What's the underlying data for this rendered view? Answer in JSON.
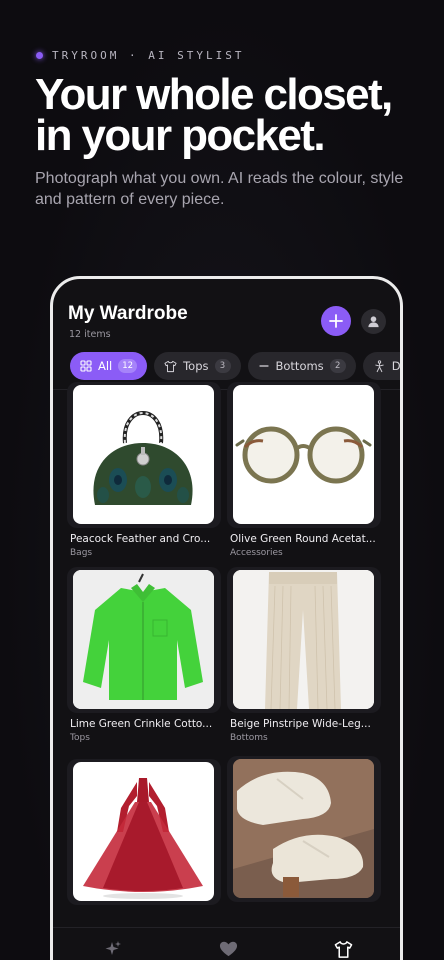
{
  "hero": {
    "eyebrow": "TRYROOM · AI STYLIST",
    "headline_line1": "Your whole closet,",
    "headline_line2": "in your pocket.",
    "subhead": "Photograph what you own. AI reads the colour, style and pattern of every piece."
  },
  "app": {
    "title": "My Wardrobe",
    "count": "12 items",
    "accent": "#8b5cf6",
    "chips": [
      {
        "label": "All",
        "count": "12",
        "icon": "grid-icon",
        "active": true
      },
      {
        "label": "Tops",
        "count": "3",
        "icon": "shirt-icon",
        "active": false
      },
      {
        "label": "Bottoms",
        "count": "2",
        "icon": "minus-icon",
        "active": false
      },
      {
        "label": "Dr",
        "count": "",
        "icon": "dress-icon",
        "active": false
      }
    ],
    "items": [
      {
        "name": "Peacock Feather and Cro...",
        "category": "Bags"
      },
      {
        "name": "Olive Green Round Acetat...",
        "category": "Accessories"
      },
      {
        "name": "Lime Green Crinkle Cotto...",
        "category": "Tops"
      },
      {
        "name": "Beige Pinstripe Wide-Leg...",
        "category": "Bottoms"
      },
      {
        "name": "",
        "category": ""
      },
      {
        "name": "",
        "category": ""
      }
    ],
    "tabs": [
      "sparkles-icon",
      "heart-icon",
      "shirt-icon"
    ]
  }
}
